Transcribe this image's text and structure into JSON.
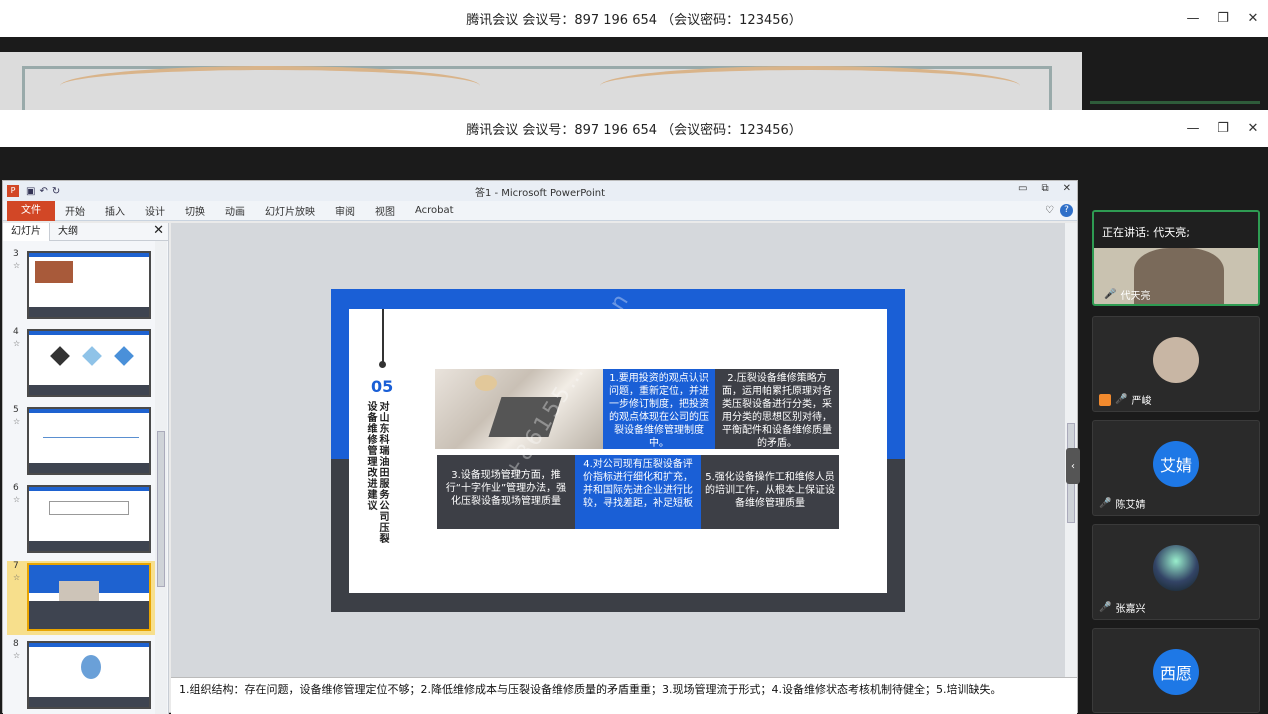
{
  "window_title": "腾讯会议 会议号：897 196 654 （会议密码：123456）",
  "window_title2": "腾讯会议 会议号：897 196 654 （会议密码：123456）",
  "ppt": {
    "title": "答1 - Microsoft PowerPoint",
    "file_tab": "文件",
    "tabs": [
      "开始",
      "插入",
      "设计",
      "切换",
      "动画",
      "幻灯片放映",
      "审阅",
      "视图",
      "Acrobat"
    ],
    "panel_tabs": [
      "幻灯片",
      "大纲"
    ],
    "slide_numbers": [
      "3",
      "4",
      "5",
      "6",
      "7",
      "8"
    ],
    "selected_slide": "7",
    "notes": "1.组织结构：存在问题，设备维修管理定位不够；2.降低维修成本与压裂设备维修质量的矛盾重重；3.现场管理流于形式；4.设备维修状态考核机制待健全；5.培训缺失。"
  },
  "slide": {
    "number": "05",
    "title_col1": "设备维修管理改进建议",
    "title_col2": "对山东科瑞油田服务公司压裂",
    "box1": "1.要用投资的观点认识问题，重新定位，并进一步修订制度，把投资的观点体现在公司的压裂设备维修管理制度中。",
    "box2": "2.压裂设备维修策略方面，运用帕累托原理对各类压裂设备进行分类，采用分类的思想区别对待，平衡配件和设备维修质量的矛盾。",
    "box3": "3.设备现场管理方面，推行“十字作业”管理办法，强化压裂设备现场管理质量",
    "box4": "4.对公司现有压裂设备评价指标进行细化和扩充，并和国际先进企业进行比较，寻找差距，补足短板",
    "box5": "5.强化设备操作工和维修人员的培训工作，从根本上保证设备维修管理质量",
    "watermark": "+86155………un"
  },
  "participants": {
    "speaking_label": "正在讲话: 代天亮;",
    "speaker": "代天亮",
    "list": [
      {
        "name": "严峻",
        "avatar_text": ""
      },
      {
        "name": "陈艾婧",
        "avatar_text": "艾婧"
      },
      {
        "name": "张嘉兴",
        "avatar_text": ""
      },
      {
        "name": "",
        "avatar_text": "西愿"
      }
    ]
  },
  "colors": {
    "slide_blue": "#1a5fd6",
    "slide_dark": "#3d3f46",
    "ppt_file": "#d24726",
    "speaking_border": "#2e9b52"
  }
}
